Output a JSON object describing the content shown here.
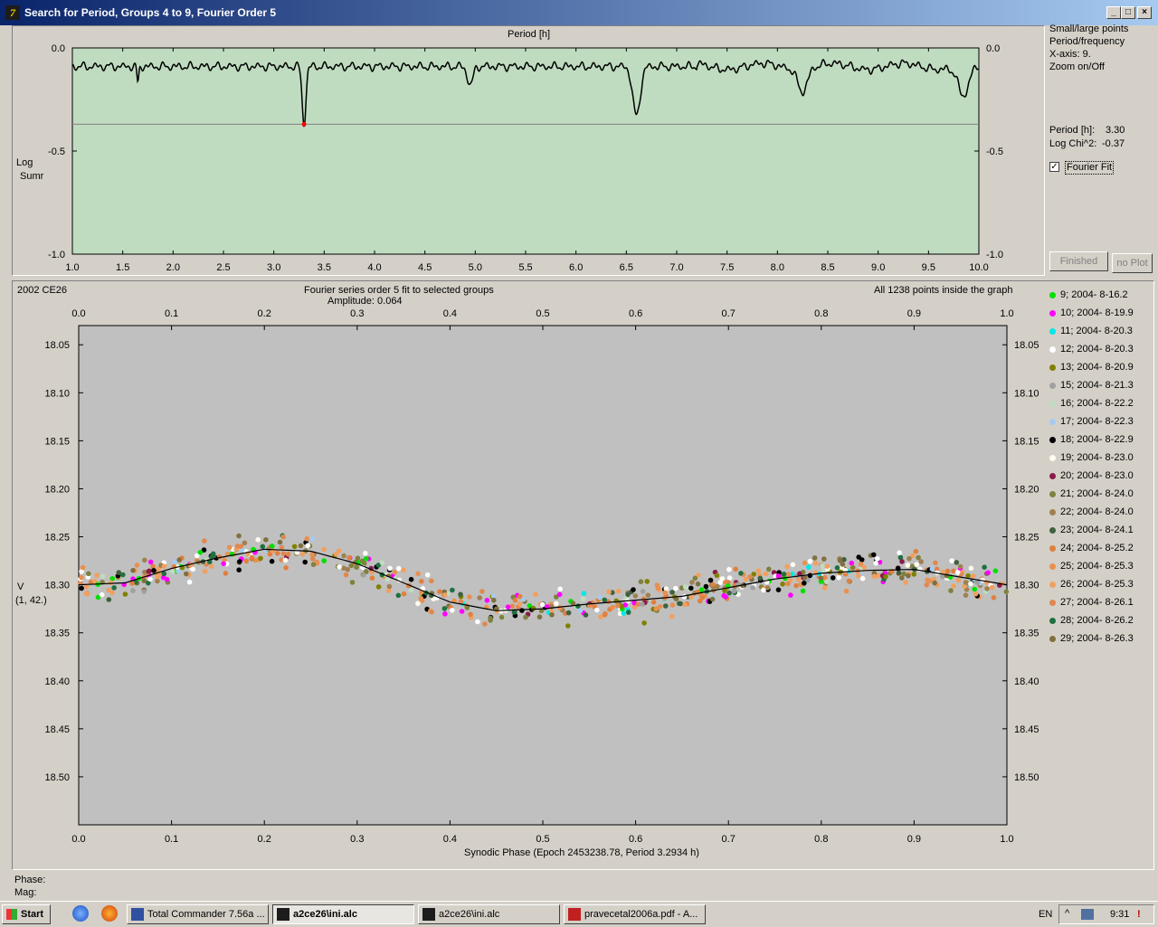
{
  "window": {
    "title": "Search for Period, Groups 4 to 9, Fourier Order 5",
    "icon_label": "7"
  },
  "top_chart": {
    "title": "Period [h]",
    "ylabel_1": "Log",
    "ylabel_2": "Sumr",
    "xticks": [
      "1.0",
      "1.5",
      "2.0",
      "2.5",
      "3.0",
      "3.5",
      "4.0",
      "4.5",
      "5.0",
      "5.5",
      "6.0",
      "6.5",
      "7.0",
      "7.5",
      "8.0",
      "8.5",
      "9.0",
      "9.5",
      "10.0"
    ],
    "yticks": [
      "0.0",
      "-0.5",
      "-1.0"
    ]
  },
  "side_panel": {
    "small_large": "Small/large points",
    "period_freq": "Period/frequency",
    "xaxis": "X-axis: 9.",
    "zoom": "Zoom on/Off",
    "period_label": "Period [h]:",
    "period_value": "3.30",
    "chi_label": "Log Chi^2:",
    "chi_value": "-0.37",
    "fourier_label": "Fourier Fit",
    "fourier_checked": "✓",
    "finished_btn": "Finished",
    "noplot_btn": "no Plot"
  },
  "bottom_chart": {
    "object": "2002 CE26",
    "fit_text": "Fourier series order 5 fit to selected groups",
    "amplitude": "Amplitude: 0.064",
    "points_text": "All 1238 points inside the graph",
    "ylabel": "V",
    "ylabel2": "(1, 42.)",
    "xlabel": "Synodic Phase (Epoch 2453238.78, Period 3.2934 h)",
    "xticks": [
      "0.0",
      "0.1",
      "0.2",
      "0.3",
      "0.4",
      "0.5",
      "0.6",
      "0.7",
      "0.8",
      "0.9",
      "1.0"
    ],
    "yticks": [
      "18.05",
      "18.10",
      "18.15",
      "18.20",
      "18.25",
      "18.30",
      "18.35",
      "18.40",
      "18.45",
      "18.50"
    ]
  },
  "legend": [
    {
      "label": "9; 2004- 8-16.2",
      "color": "#00e000"
    },
    {
      "label": "10; 2004- 8-19.9",
      "color": "#ff00ff"
    },
    {
      "label": "11; 2004- 8-20.3",
      "color": "#00e8e8"
    },
    {
      "label": "12; 2004- 8-20.3",
      "color": "#ffffff"
    },
    {
      "label": "13; 2004- 8-20.9",
      "color": "#808000"
    },
    {
      "label": "15; 2004- 8-21.3",
      "color": "#a0a0a0"
    },
    {
      "label": "16; 2004- 8-22.2",
      "color": "#c0dcc0"
    },
    {
      "label": "17; 2004- 8-22.3",
      "color": "#a6caf0"
    },
    {
      "label": "18; 2004- 8-22.9",
      "color": "#000000"
    },
    {
      "label": "19; 2004- 8-23.0",
      "color": "#fffbf0"
    },
    {
      "label": "20; 2004- 8-23.0",
      "color": "#8b1a4a"
    },
    {
      "label": "21; 2004- 8-24.0",
      "color": "#808040"
    },
    {
      "label": "22; 2004- 8-24.0",
      "color": "#a08050"
    },
    {
      "label": "23; 2004- 8-24.1",
      "color": "#406040"
    },
    {
      "label": "24; 2004- 8-25.2",
      "color": "#e08040"
    },
    {
      "label": "25; 2004- 8-25.3",
      "color": "#e89050"
    },
    {
      "label": "26; 2004- 8-25.3",
      "color": "#f0a060"
    },
    {
      "label": "27; 2004- 8-26.1",
      "color": "#e08850"
    },
    {
      "label": "28; 2004- 8-26.2",
      "color": "#207040"
    },
    {
      "label": "29; 2004- 8-26.3",
      "color": "#807040"
    }
  ],
  "status": {
    "phase": "Phase:",
    "mag": "Mag:"
  },
  "taskbar": {
    "start": "Start",
    "tasks": [
      "Total Commander 7.56a ...",
      "a2ce26\\ini.alc",
      "a2ce26\\ini.alc",
      "pravecetal2006a.pdf - A..."
    ],
    "lang": "EN",
    "clock": "9:31"
  },
  "chart_data": [
    {
      "type": "line",
      "title": "Period [h]",
      "xlabel": "",
      "ylabel": "Log Sumr",
      "xlim": [
        1.0,
        10.0
      ],
      "ylim": [
        -1.0,
        0.0
      ],
      "selected_period": 3.3,
      "selected_log": -0.37,
      "reference_level": -0.37,
      "dips": [
        {
          "x": 1.65,
          "y": -0.17
        },
        {
          "x": 3.3,
          "y": -0.37
        },
        {
          "x": 4.95,
          "y": -0.18
        },
        {
          "x": 6.6,
          "y": -0.33
        },
        {
          "x": 8.25,
          "y": -0.2
        },
        {
          "x": 9.85,
          "y": -0.24
        }
      ],
      "baseline": -0.09
    },
    {
      "type": "scatter",
      "xlabel": "Synodic Phase (Epoch 2453238.78, Period 3.2934 h)",
      "ylabel": "V",
      "xlim": [
        0.0,
        1.0
      ],
      "ylim": [
        18.55,
        18.03
      ],
      "fit_curve": {
        "x": [
          0.0,
          0.05,
          0.1,
          0.15,
          0.2,
          0.25,
          0.3,
          0.35,
          0.4,
          0.45,
          0.5,
          0.55,
          0.6,
          0.65,
          0.7,
          0.75,
          0.8,
          0.85,
          0.9,
          0.95,
          1.0
        ],
        "y": [
          18.3,
          18.298,
          18.283,
          18.272,
          18.263,
          18.265,
          18.278,
          18.298,
          18.318,
          18.327,
          18.325,
          18.32,
          18.316,
          18.312,
          18.303,
          18.294,
          18.288,
          18.285,
          18.284,
          18.292,
          18.3
        ]
      },
      "points_count": 1238
    }
  ]
}
